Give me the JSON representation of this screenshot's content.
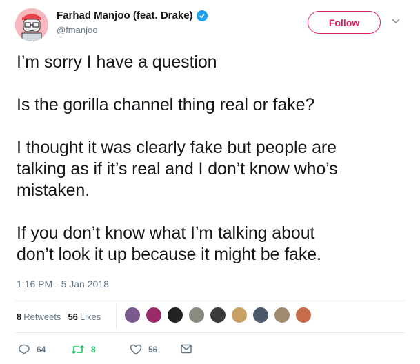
{
  "author": {
    "display_name": "Farhad Manjoo (feat. Drake)",
    "handle": "@fmanjoo",
    "verified_icon": "verified-badge-icon"
  },
  "header": {
    "follow_label": "Follow",
    "menu_icon": "chevron-down-icon"
  },
  "tweet": {
    "lines": [
      "I’m sorry I have a question",
      "Is the gorilla channel thing real or fake?",
      "I thought it was clearly fake but people are",
      "talking as if it’s real and I don’t know who’s",
      "mistaken.",
      "If you don’t know what I’m talking about",
      "don’t look it up because it might be fake."
    ],
    "timestamp": "1:16 PM - 5 Jan 2018"
  },
  "stats": {
    "retweets_count": "8",
    "retweets_label": "Retweets",
    "likes_count": "56",
    "likes_label": "Likes"
  },
  "liker_avatars": [
    {
      "name": "liker-avatar-1",
      "color": "#7a5a8c"
    },
    {
      "name": "liker-avatar-2",
      "color": "#9b2a6b"
    },
    {
      "name": "liker-avatar-3",
      "color": "#222222"
    },
    {
      "name": "liker-avatar-4",
      "color": "#8a8a80"
    },
    {
      "name": "liker-avatar-5",
      "color": "#3b3b3b"
    },
    {
      "name": "liker-avatar-6",
      "color": "#c9a063"
    },
    {
      "name": "liker-avatar-7",
      "color": "#4a5a6a"
    },
    {
      "name": "liker-avatar-8",
      "color": "#a08a70"
    },
    {
      "name": "liker-avatar-9",
      "color": "#c76c4a"
    }
  ],
  "actions": {
    "reply_count": "64",
    "retweet_count": "8",
    "like_count": "56"
  },
  "colors": {
    "accent": "#e0245e",
    "verified": "#1da1f2",
    "retweet": "#17bf63",
    "muted": "#657786"
  }
}
